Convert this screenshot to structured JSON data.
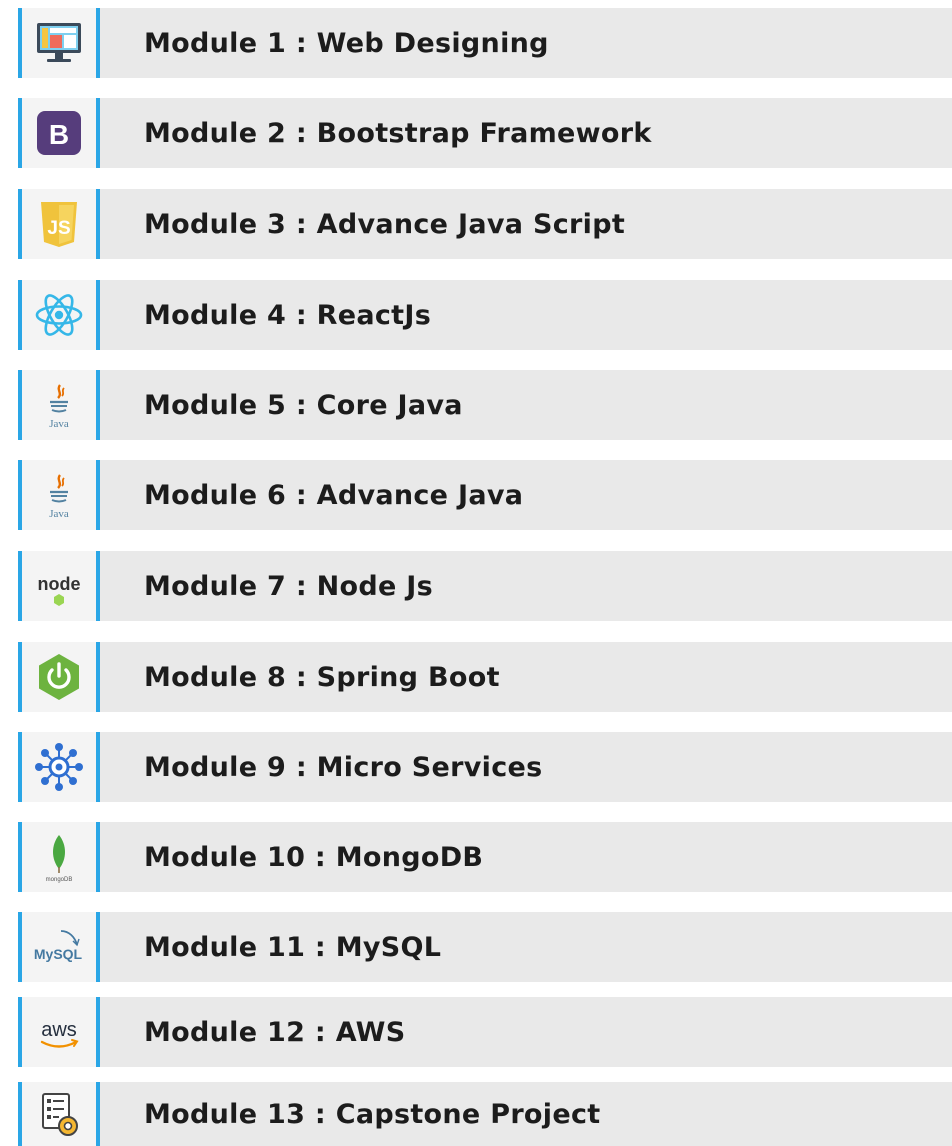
{
  "modules": [
    {
      "label": "Module 1 : Web Designing",
      "icon": "web-designing-icon"
    },
    {
      "label": "Module 2 : Bootstrap Framework",
      "icon": "bootstrap-icon",
      "icon_text": "B"
    },
    {
      "label": "Module 3 : Advance Java Script",
      "icon": "javascript-icon",
      "icon_text": "JS"
    },
    {
      "label": "Module 4 : ReactJs",
      "icon": "react-icon"
    },
    {
      "label": "Module 5 : Core Java",
      "icon": "java-icon",
      "icon_text": "Java"
    },
    {
      "label": "Module 6 : Advance Java",
      "icon": "java-icon",
      "icon_text": "Java"
    },
    {
      "label": "Module 7 : Node Js",
      "icon": "nodejs-icon",
      "icon_text": "node"
    },
    {
      "label": "Module 8 : Spring Boot",
      "icon": "spring-boot-icon"
    },
    {
      "label": "Module 9 : Micro Services",
      "icon": "microservices-icon"
    },
    {
      "label": "Module 10 : MongoDB",
      "icon": "mongodb-icon",
      "icon_text": "mongoDB"
    },
    {
      "label": "Module 11 : MySQL",
      "icon": "mysql-icon",
      "icon_text": "MySQL"
    },
    {
      "label": "Module 12 : AWS",
      "icon": "aws-icon",
      "icon_text": "aws"
    },
    {
      "label": "Module 13 : Capstone Project",
      "icon": "capstone-project-icon"
    }
  ],
  "colors": {
    "accent_border": "#2aa6e6",
    "row_background": "#e9e9e9",
    "bootstrap_purple": "#563d7c",
    "javascript_yellow": "#f0c33c",
    "react_cyan": "#35b7e8",
    "spring_green": "#6db33f",
    "microservices_blue": "#2f6fd1",
    "mongodb_green": "#4aa841",
    "aws_orange": "#f29100"
  }
}
